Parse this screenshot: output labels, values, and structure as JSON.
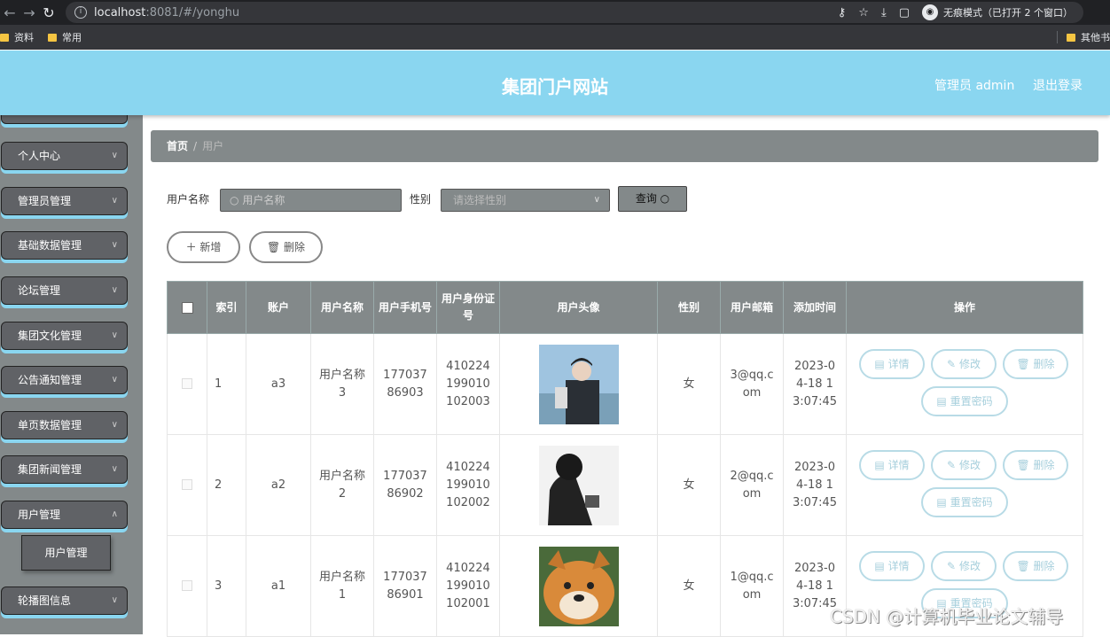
{
  "browser": {
    "url_host": "localhost",
    "url_path": ":8081/#/yonghu",
    "incognito_label": "无痕模式（已打开 2 个窗口）",
    "bookmarks": [
      "资料",
      "常用"
    ],
    "bookmarks_right": "其他书"
  },
  "header": {
    "title": "集团门户网站",
    "user": "管理员 admin",
    "logout": "退出登录"
  },
  "sidebar": {
    "items": [
      "个人中心",
      "管理员管理",
      "基础数据管理",
      "论坛管理",
      "集团文化管理",
      "公告通知管理",
      "单页数据管理",
      "集团新闻管理",
      "用户管理",
      "轮播图信息"
    ],
    "sub_item": "用户管理"
  },
  "breadcrumb": {
    "home": "首页",
    "sep": "/",
    "current": "用户"
  },
  "search": {
    "name_label": "用户名称",
    "name_placeholder": "用户名称",
    "sex_label": "性别",
    "sex_placeholder": "请选择性别",
    "query_button": "查询"
  },
  "actions": {
    "add": "新增",
    "delete": "删除"
  },
  "table": {
    "headers": [
      "索引",
      "账户",
      "用户名称",
      "用户手机号",
      "用户身份证号",
      "用户头像",
      "性别",
      "用户邮箱",
      "添加时间",
      "操作"
    ],
    "rows": [
      {
        "index": "1",
        "account": "a3",
        "name": "用户名称3",
        "phone": "17703786903",
        "id_card": "410224199010102003",
        "sex": "女",
        "email": "3@qq.com",
        "time": "2023-04-18 13:07:45"
      },
      {
        "index": "2",
        "account": "a2",
        "name": "用户名称2",
        "phone": "17703786902",
        "id_card": "410224199010102002",
        "sex": "女",
        "email": "2@qq.com",
        "time": "2023-04-18 13:07:45"
      },
      {
        "index": "3",
        "account": "a1",
        "name": "用户名称1",
        "phone": "17703786901",
        "id_card": "410224199010102001",
        "sex": "女",
        "email": "1@qq.com",
        "time": "2023-04-18 13:07:45"
      }
    ],
    "row_buttons": {
      "detail": "详情",
      "edit": "修改",
      "delete": "删除",
      "reset": "重置密码"
    }
  },
  "watermark": "CSDN @计算机毕业论文辅导"
}
